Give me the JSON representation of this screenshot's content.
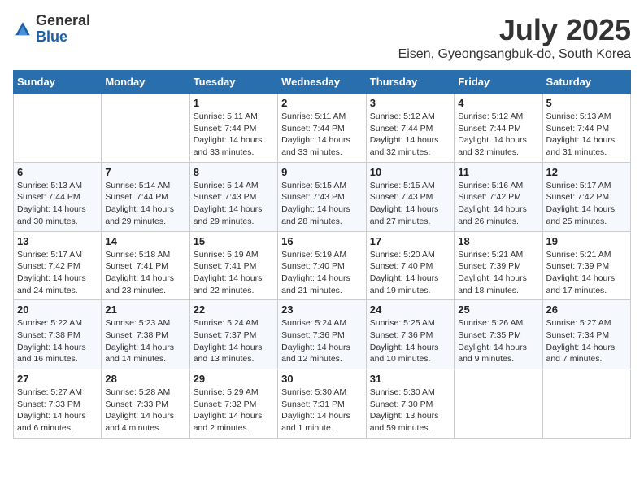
{
  "logo": {
    "text_general": "General",
    "text_blue": "Blue"
  },
  "title": "July 2025",
  "subtitle": "Eisen, Gyeongsangbuk-do, South Korea",
  "days_of_week": [
    "Sunday",
    "Monday",
    "Tuesday",
    "Wednesday",
    "Thursday",
    "Friday",
    "Saturday"
  ],
  "weeks": [
    [
      {
        "day": "",
        "info": ""
      },
      {
        "day": "",
        "info": ""
      },
      {
        "day": "1",
        "info": "Sunrise: 5:11 AM\nSunset: 7:44 PM\nDaylight: 14 hours and 33 minutes."
      },
      {
        "day": "2",
        "info": "Sunrise: 5:11 AM\nSunset: 7:44 PM\nDaylight: 14 hours and 33 minutes."
      },
      {
        "day": "3",
        "info": "Sunrise: 5:12 AM\nSunset: 7:44 PM\nDaylight: 14 hours and 32 minutes."
      },
      {
        "day": "4",
        "info": "Sunrise: 5:12 AM\nSunset: 7:44 PM\nDaylight: 14 hours and 32 minutes."
      },
      {
        "day": "5",
        "info": "Sunrise: 5:13 AM\nSunset: 7:44 PM\nDaylight: 14 hours and 31 minutes."
      }
    ],
    [
      {
        "day": "6",
        "info": "Sunrise: 5:13 AM\nSunset: 7:44 PM\nDaylight: 14 hours and 30 minutes."
      },
      {
        "day": "7",
        "info": "Sunrise: 5:14 AM\nSunset: 7:44 PM\nDaylight: 14 hours and 29 minutes."
      },
      {
        "day": "8",
        "info": "Sunrise: 5:14 AM\nSunset: 7:43 PM\nDaylight: 14 hours and 29 minutes."
      },
      {
        "day": "9",
        "info": "Sunrise: 5:15 AM\nSunset: 7:43 PM\nDaylight: 14 hours and 28 minutes."
      },
      {
        "day": "10",
        "info": "Sunrise: 5:15 AM\nSunset: 7:43 PM\nDaylight: 14 hours and 27 minutes."
      },
      {
        "day": "11",
        "info": "Sunrise: 5:16 AM\nSunset: 7:42 PM\nDaylight: 14 hours and 26 minutes."
      },
      {
        "day": "12",
        "info": "Sunrise: 5:17 AM\nSunset: 7:42 PM\nDaylight: 14 hours and 25 minutes."
      }
    ],
    [
      {
        "day": "13",
        "info": "Sunrise: 5:17 AM\nSunset: 7:42 PM\nDaylight: 14 hours and 24 minutes."
      },
      {
        "day": "14",
        "info": "Sunrise: 5:18 AM\nSunset: 7:41 PM\nDaylight: 14 hours and 23 minutes."
      },
      {
        "day": "15",
        "info": "Sunrise: 5:19 AM\nSunset: 7:41 PM\nDaylight: 14 hours and 22 minutes."
      },
      {
        "day": "16",
        "info": "Sunrise: 5:19 AM\nSunset: 7:40 PM\nDaylight: 14 hours and 21 minutes."
      },
      {
        "day": "17",
        "info": "Sunrise: 5:20 AM\nSunset: 7:40 PM\nDaylight: 14 hours and 19 minutes."
      },
      {
        "day": "18",
        "info": "Sunrise: 5:21 AM\nSunset: 7:39 PM\nDaylight: 14 hours and 18 minutes."
      },
      {
        "day": "19",
        "info": "Sunrise: 5:21 AM\nSunset: 7:39 PM\nDaylight: 14 hours and 17 minutes."
      }
    ],
    [
      {
        "day": "20",
        "info": "Sunrise: 5:22 AM\nSunset: 7:38 PM\nDaylight: 14 hours and 16 minutes."
      },
      {
        "day": "21",
        "info": "Sunrise: 5:23 AM\nSunset: 7:38 PM\nDaylight: 14 hours and 14 minutes."
      },
      {
        "day": "22",
        "info": "Sunrise: 5:24 AM\nSunset: 7:37 PM\nDaylight: 14 hours and 13 minutes."
      },
      {
        "day": "23",
        "info": "Sunrise: 5:24 AM\nSunset: 7:36 PM\nDaylight: 14 hours and 12 minutes."
      },
      {
        "day": "24",
        "info": "Sunrise: 5:25 AM\nSunset: 7:36 PM\nDaylight: 14 hours and 10 minutes."
      },
      {
        "day": "25",
        "info": "Sunrise: 5:26 AM\nSunset: 7:35 PM\nDaylight: 14 hours and 9 minutes."
      },
      {
        "day": "26",
        "info": "Sunrise: 5:27 AM\nSunset: 7:34 PM\nDaylight: 14 hours and 7 minutes."
      }
    ],
    [
      {
        "day": "27",
        "info": "Sunrise: 5:27 AM\nSunset: 7:33 PM\nDaylight: 14 hours and 6 minutes."
      },
      {
        "day": "28",
        "info": "Sunrise: 5:28 AM\nSunset: 7:33 PM\nDaylight: 14 hours and 4 minutes."
      },
      {
        "day": "29",
        "info": "Sunrise: 5:29 AM\nSunset: 7:32 PM\nDaylight: 14 hours and 2 minutes."
      },
      {
        "day": "30",
        "info": "Sunrise: 5:30 AM\nSunset: 7:31 PM\nDaylight: 14 hours and 1 minute."
      },
      {
        "day": "31",
        "info": "Sunrise: 5:30 AM\nSunset: 7:30 PM\nDaylight: 13 hours and 59 minutes."
      },
      {
        "day": "",
        "info": ""
      },
      {
        "day": "",
        "info": ""
      }
    ]
  ]
}
